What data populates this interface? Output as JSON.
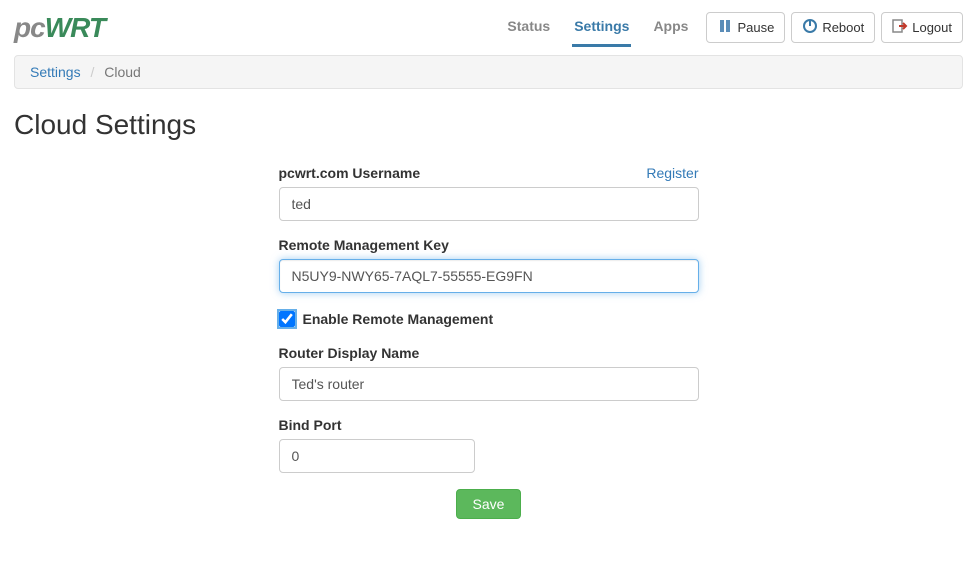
{
  "logo": {
    "part1": "pc",
    "part2": "WRT"
  },
  "nav": {
    "status": "Status",
    "settings": "Settings",
    "apps": "Apps"
  },
  "buttons": {
    "pause": "Pause",
    "reboot": "Reboot",
    "logout": "Logout"
  },
  "breadcrumb": {
    "parent": "Settings",
    "current": "Cloud"
  },
  "page_title": "Cloud Settings",
  "form": {
    "username_label": "pcwrt.com Username",
    "register_link": "Register",
    "username_value": "ted",
    "key_label": "Remote Management Key",
    "key_value": "N5UY9-NWY65-7AQL7-55555-EG9FN",
    "enable_label": "Enable Remote Management",
    "enable_checked": true,
    "display_name_label": "Router Display Name",
    "display_name_value": "Ted's router",
    "bind_port_label": "Bind Port",
    "bind_port_value": "0",
    "save_label": "Save"
  }
}
